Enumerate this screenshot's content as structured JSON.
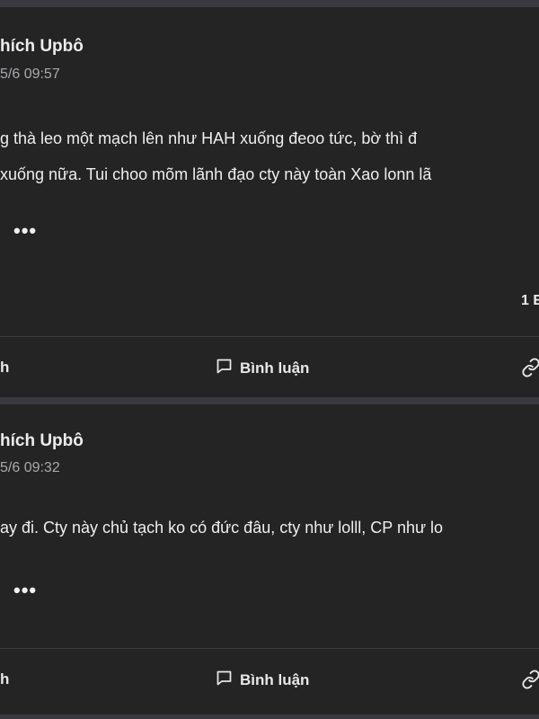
{
  "posts": [
    {
      "author": "hích Upbô",
      "timestamp": "5/6 09:57",
      "lines": [
        "g thà leo một mạch lên như HAH xuống đeoo tức, bờ thì đ",
        "xuống nữa. Tui choo mõm lãnh đạo cty này toàn Xao lonn lã"
      ],
      "more": "•••",
      "reaction_count": "1 E",
      "actions": {
        "like": "h",
        "comment": "Bình luận"
      }
    },
    {
      "author": "hích Upbô",
      "timestamp": "5/6 09:32",
      "lines": [
        "ay đi. Cty này chủ tạch ko có đức đâu, cty như lolll, CP như lo"
      ],
      "more": "•••",
      "actions": {
        "like": "h",
        "comment": "Bình luận"
      }
    }
  ],
  "icons": {
    "comment": "comment-bubble-icon",
    "share": "link-icon"
  },
  "colors": {
    "background": "#3a393f",
    "card": "#242424",
    "text": "#e8e8ea",
    "muted": "#a8a8ad"
  }
}
